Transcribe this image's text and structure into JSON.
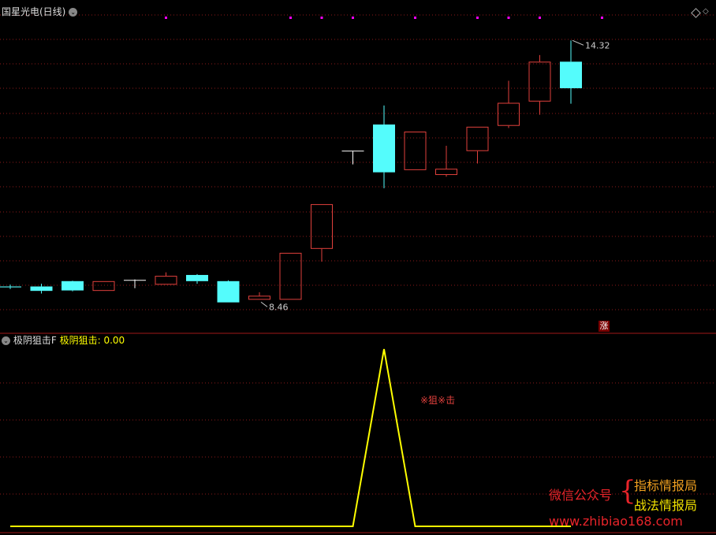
{
  "header": {
    "stock_title": "国星光电(日线)"
  },
  "indicator": {
    "name": "极阴狙击F",
    "value_label": "极阴狙击:",
    "value": "0.00"
  },
  "price_annotations": {
    "high": "14.32",
    "low": "8.46"
  },
  "badge": "涨",
  "signal_text": "※狙※击",
  "watermark": {
    "left": "微信公众号",
    "brace": "{",
    "line1": "指标情报局",
    "line2": "战法情报局",
    "url": "www.zhibiao168.com"
  },
  "colors": {
    "up": "#e0403c",
    "down": "#54fcfc",
    "doji": "#ffffff",
    "grid": "#8b1a1a",
    "indicator_line": "#ffff00",
    "marker": "#ff00ff"
  },
  "chart_data": [
    {
      "type": "candlestick",
      "title": "国星光电(日线)",
      "ylim": [
        8.2,
        14.7
      ],
      "candles": [
        {
          "o": 8.76,
          "h": 8.8,
          "l": 8.7,
          "c": 8.74
        },
        {
          "o": 8.76,
          "h": 8.82,
          "l": 8.6,
          "c": 8.66
        },
        {
          "o": 8.88,
          "h": 8.89,
          "l": 8.65,
          "c": 8.67
        },
        {
          "o": 8.66,
          "h": 8.88,
          "l": 8.66,
          "c": 8.88
        },
        {
          "o": 8.9,
          "h": 8.92,
          "l": 8.72,
          "c": 8.9
        },
        {
          "o": 8.8,
          "h": 9.08,
          "l": 8.8,
          "c": 9.0
        },
        {
          "o": 9.02,
          "h": 9.04,
          "l": 8.82,
          "c": 8.88
        },
        {
          "o": 8.88,
          "h": 8.9,
          "l": 8.4,
          "c": 8.4
        },
        {
          "o": 8.46,
          "h": 8.63,
          "l": 8.46,
          "c": 8.55
        },
        {
          "o": 8.46,
          "h": 9.52,
          "l": 8.46,
          "c": 9.52
        },
        {
          "o": 9.61,
          "h": 10.62,
          "l": 9.32,
          "c": 10.62
        },
        {
          "o": 11.82,
          "h": 11.82,
          "l": 11.52,
          "c": 11.82
        },
        {
          "o": 12.42,
          "h": 12.85,
          "l": 10.98,
          "c": 11.34
        },
        {
          "o": 11.39,
          "h": 12.26,
          "l": 11.39,
          "c": 12.26
        },
        {
          "o": 11.28,
          "h": 11.94,
          "l": 11.24,
          "c": 11.42
        },
        {
          "o": 11.82,
          "h": 12.37,
          "l": 11.54,
          "c": 12.37
        },
        {
          "o": 12.39,
          "h": 13.41,
          "l": 12.34,
          "c": 12.91
        },
        {
          "o": 12.94,
          "h": 13.99,
          "l": 12.64,
          "c": 13.84
        },
        {
          "o": 13.84,
          "h": 14.32,
          "l": 12.89,
          "c": 13.24
        }
      ],
      "annotations": [
        {
          "text": "14.32",
          "value": 14.32
        },
        {
          "text": "8.46",
          "value": 8.46
        }
      ],
      "markers_top": [
        5,
        9,
        10,
        11,
        13,
        15,
        16,
        17,
        19
      ]
    },
    {
      "type": "line",
      "title": "极阴狙击F",
      "series": [
        {
          "name": "极阴狙击",
          "values": [
            0,
            0,
            0,
            0,
            0,
            0,
            0,
            0,
            0,
            0,
            0,
            0,
            1,
            0,
            0,
            0,
            0,
            0,
            0
          ]
        }
      ],
      "ylim": [
        0,
        1
      ]
    }
  ]
}
